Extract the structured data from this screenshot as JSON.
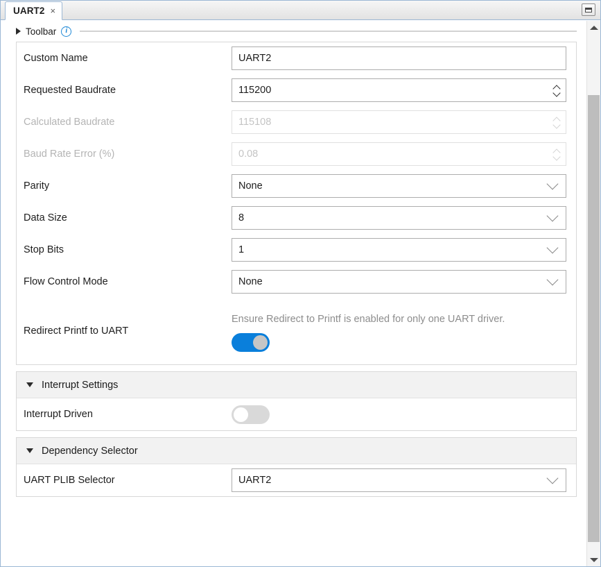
{
  "window": {
    "restore_button_name": "restore-window",
    "accent_color": "#0a7fdb"
  },
  "tab": {
    "label": "UART2",
    "close_glyph": "×"
  },
  "toolbar": {
    "label": "Toolbar",
    "info_glyph": "i"
  },
  "general": {
    "rows": [
      {
        "label": "Custom Name",
        "value": "UART2",
        "type": "text",
        "disabled": false
      },
      {
        "label": "Requested Baudrate",
        "value": "115200",
        "type": "spinner",
        "disabled": false
      },
      {
        "label": "Calculated Baudrate",
        "value": "115108",
        "type": "spinner",
        "disabled": true
      },
      {
        "label": "Baud Rate Error (%)",
        "value": "0.08",
        "type": "spinner",
        "disabled": true
      },
      {
        "label": "Parity",
        "value": "None",
        "type": "dropdown",
        "disabled": false
      },
      {
        "label": "Data Size",
        "value": "8",
        "type": "dropdown",
        "disabled": false
      },
      {
        "label": "Stop Bits",
        "value": "1",
        "type": "dropdown",
        "disabled": false
      },
      {
        "label": "Flow Control Mode",
        "value": "None",
        "type": "dropdown",
        "disabled": false
      }
    ],
    "printf": {
      "label": "Redirect Printf to UART",
      "hint": "Ensure Redirect to Printf is enabled for only one UART driver.",
      "toggle_state": "on"
    }
  },
  "interrupt_section": {
    "title": "Interrupt Settings",
    "row": {
      "label": "Interrupt Driven",
      "toggle_state": "off"
    }
  },
  "dependency_section": {
    "title": "Dependency Selector",
    "row": {
      "label": "UART PLIB Selector",
      "value": "UART2",
      "type": "dropdown"
    }
  }
}
